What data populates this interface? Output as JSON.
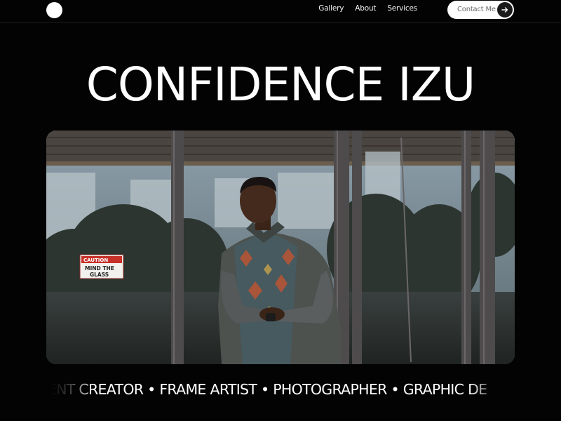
{
  "nav": {
    "links": [
      "Gallery",
      "About",
      "Services"
    ],
    "contact_label": "Contact Me",
    "contact_icon": "arrow-right-icon"
  },
  "hero": {
    "title": "CONFIDENCE IZU",
    "photo_sign_line1": "CAUTION",
    "photo_sign_line2": "MIND THE",
    "photo_sign_line3": "GLASS"
  },
  "ticker": {
    "text": "TENT CREATOR • FRAME ARTIST • PHOTOGRAPHER • GRAPHIC DE"
  }
}
